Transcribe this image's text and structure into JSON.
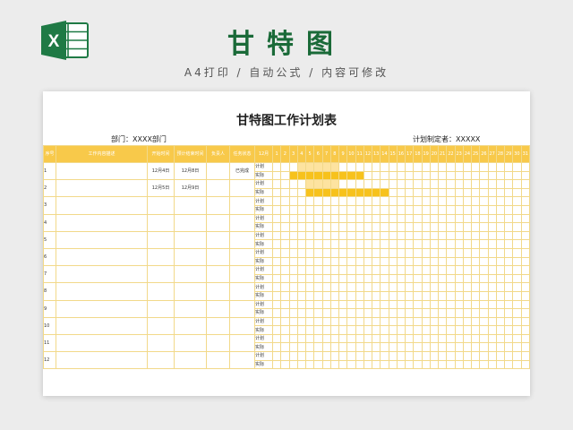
{
  "banner": {
    "title": "甘特图",
    "subtitle": "A4打印 / 自动公式 / 内容可修改",
    "logo_letter": "X"
  },
  "document": {
    "title": "甘特图工作计划表",
    "department": "部门：XXXX部门",
    "planner": "计划制定者：XXXXX"
  },
  "table": {
    "headers": [
      "序号",
      "工作内容描述",
      "开始时间",
      "预计结束时间",
      "负责人",
      "任务状态",
      "12月"
    ],
    "days": [
      "1",
      "2",
      "3",
      "4",
      "5",
      "6",
      "7",
      "8",
      "9",
      "10",
      "11",
      "12",
      "13",
      "14",
      "15",
      "16",
      "17",
      "18",
      "19",
      "20",
      "21",
      "22",
      "23",
      "24",
      "25",
      "26",
      "27",
      "28",
      "29",
      "30",
      "31"
    ],
    "plan_label": "计划",
    "actual_label": "实际",
    "rows": [
      {
        "no": "1",
        "desc": "",
        "start": "12月4日",
        "end": "12月8日",
        "owner": "",
        "status": "已完成",
        "plan": [
          4,
          8
        ],
        "actual": [
          3,
          11
        ]
      },
      {
        "no": "2",
        "desc": "",
        "start": "12月5日",
        "end": "12月9日",
        "owner": "",
        "status": "",
        "plan": [
          5,
          8
        ],
        "actual": [
          5,
          14
        ]
      },
      {
        "no": "3",
        "desc": "",
        "start": "",
        "end": "",
        "owner": "",
        "status": ""
      },
      {
        "no": "4",
        "desc": "",
        "start": "",
        "end": "",
        "owner": "",
        "status": ""
      },
      {
        "no": "5",
        "desc": "",
        "start": "",
        "end": "",
        "owner": "",
        "status": ""
      },
      {
        "no": "6",
        "desc": "",
        "start": "",
        "end": "",
        "owner": "",
        "status": ""
      },
      {
        "no": "7",
        "desc": "",
        "start": "",
        "end": "",
        "owner": "",
        "status": ""
      },
      {
        "no": "8",
        "desc": "",
        "start": "",
        "end": "",
        "owner": "",
        "status": ""
      },
      {
        "no": "9",
        "desc": "",
        "start": "",
        "end": "",
        "owner": "",
        "status": ""
      },
      {
        "no": "10",
        "desc": "",
        "start": "",
        "end": "",
        "owner": "",
        "status": ""
      },
      {
        "no": "11",
        "desc": "",
        "start": "",
        "end": "",
        "owner": "",
        "status": ""
      },
      {
        "no": "12",
        "desc": "",
        "start": "",
        "end": "",
        "owner": "",
        "status": ""
      }
    ]
  },
  "colors": {
    "header_bg": "#f8c94a",
    "grid_line": "#f2d98a",
    "bar_plan": "#fde3a0",
    "bar_actual": "#f7c21c",
    "brand_green": "#1a6a38"
  }
}
